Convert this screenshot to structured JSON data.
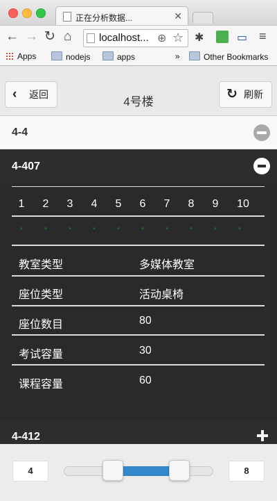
{
  "browser": {
    "tab_title": "正在分析数据...",
    "url": "localhost...",
    "bookmarks": [
      "Apps",
      "nodejs",
      "apps"
    ],
    "overflow": "»",
    "other_bookmarks": "Other Bookmarks"
  },
  "header": {
    "back_label": "返回",
    "title": "4号楼",
    "refresh_label": "刷新"
  },
  "sections": {
    "collapsed_top": "4-4",
    "expanded": "4-407",
    "collapsed_bottom": "4-412"
  },
  "weeks": [
    "1",
    "2",
    "3",
    "4",
    "5",
    "6",
    "7",
    "8",
    "9",
    "10"
  ],
  "availability": [
    "*",
    "*",
    "*",
    "*",
    "*",
    "*",
    "*",
    "*",
    "*",
    "*"
  ],
  "details": [
    {
      "key": "教室类型",
      "value": "多媒体教室"
    },
    {
      "key": "座位类型",
      "value": "活动桌椅"
    },
    {
      "key": "座位数目",
      "value": "80"
    },
    {
      "key": "考试容量",
      "value": "30"
    },
    {
      "key": "课程容量",
      "value": "60"
    }
  ],
  "slider": {
    "min_value": "4",
    "max_value": "8",
    "accent": "#3388cc"
  }
}
